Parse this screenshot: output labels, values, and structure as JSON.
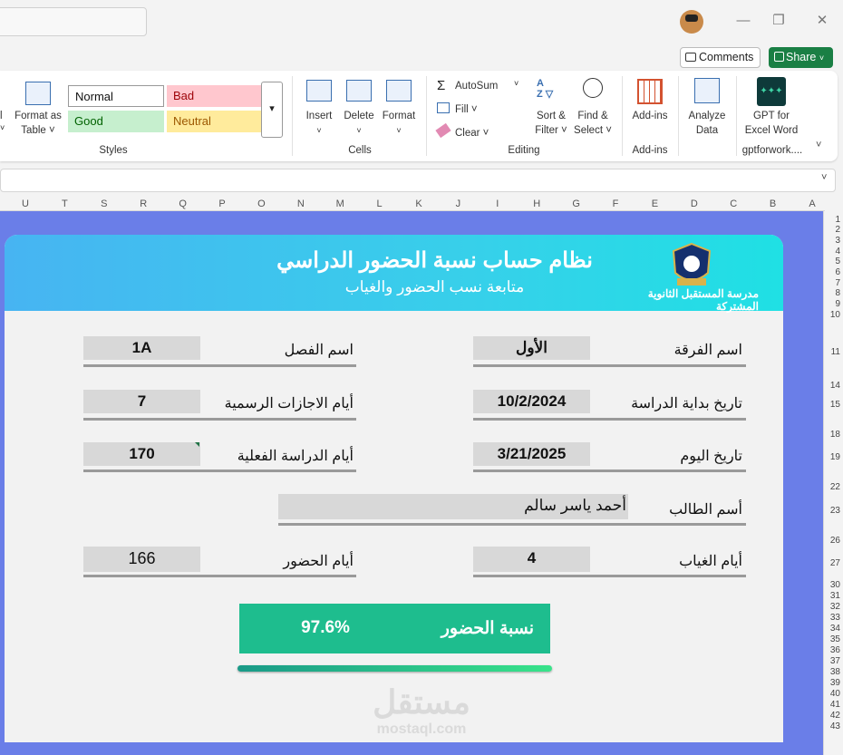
{
  "window": {
    "comments_label": "Comments",
    "share_label": "Share",
    "minimize": "—",
    "restore": "❐",
    "close": "✕"
  },
  "ribbon": {
    "format_table": {
      "label1": "Format as",
      "label2": "Table ˅",
      "partial": "l"
    },
    "styles": {
      "normal": "Normal",
      "bad": "Bad",
      "good": "Good",
      "neutral": "Neutral",
      "group": "Styles"
    },
    "cells": {
      "insert": "Insert",
      "delete": "Delete",
      "format": "Format",
      "group": "Cells"
    },
    "editing": {
      "autosum": "AutoSum",
      "fill": "Fill",
      "clear": "Clear",
      "sort_filter1": "Sort &",
      "sort_filter2": "Filter",
      "find_select1": "Find &",
      "find_select2": "Select",
      "group": "Editing"
    },
    "addins": {
      "label": "Add-ins",
      "group": "Add-ins"
    },
    "analyze": {
      "label1": "Analyze",
      "label2": "Data"
    },
    "gpt": {
      "label1": "GPT for",
      "label2": "Excel Word",
      "group": "gptforwork...."
    }
  },
  "columns": [
    "U",
    "T",
    "S",
    "R",
    "Q",
    "P",
    "O",
    "N",
    "M",
    "L",
    "K",
    "J",
    "I",
    "H",
    "G",
    "F",
    "E",
    "D",
    "C",
    "B",
    "A"
  ],
  "rows": [
    "1",
    "2",
    "3",
    "4",
    "5",
    "6",
    "7",
    "8",
    "9",
    "10",
    "11",
    "14",
    "15",
    "18",
    "19",
    "22",
    "23",
    "26",
    "27",
    "30",
    "31",
    "32",
    "33",
    "34",
    "35",
    "36",
    "37",
    "38",
    "39",
    "40",
    "41",
    "42",
    "43"
  ],
  "form": {
    "title": "نظام حساب نسبة الحضور الدراسي",
    "subtitle": "متابعة نسب الحضور والغياب",
    "school": "مدرسة المستقبل الثانوية المشتركة",
    "fields": {
      "grade_label": "اسم الفرقة",
      "grade_value": "الأول",
      "class_label": "اسم الفصل",
      "class_value": "1A",
      "start_label": "تاريخ بداية الدراسة",
      "start_value": "10/2/2024",
      "holidays_label": "أيام الاجازات الرسمية",
      "holidays_value": "7",
      "today_label": "تاريخ اليوم",
      "today_value": "3/21/2025",
      "study_label": "أيام الدراسة الفعلية",
      "study_value": "170",
      "student_label": "أسم الطالب",
      "student_value": "أحمد ياسر سالم",
      "absence_label": "أيام الغياب",
      "absence_value": "4",
      "attendance_label": "أيام الحضور",
      "attendance_value": "166"
    },
    "rate_label": "نسبة الحضور",
    "rate_value": "97.6%",
    "rate_fraction": 0.976
  },
  "watermark": {
    "arabic": "مستقل",
    "latin": "mostaql.com"
  },
  "colors": {
    "sheet_bg": "#6a7ee8",
    "rate_bg": "#1ebd8e",
    "excel_green": "#1a7f44"
  }
}
